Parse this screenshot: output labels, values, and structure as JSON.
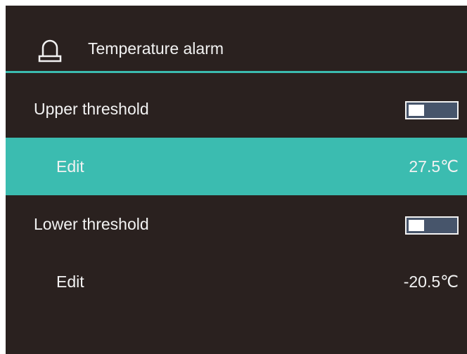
{
  "header": {
    "icon": "alarm-beacon-icon",
    "title": "Temperature alarm"
  },
  "rows": [
    {
      "label": "Upper threshold",
      "control": "toggle",
      "toggle_on": false
    },
    {
      "label": "Edit",
      "value": "27.5℃",
      "selected": true
    },
    {
      "label": "Lower threshold",
      "control": "toggle",
      "toggle_on": false
    },
    {
      "label": "Edit",
      "value": "-20.5℃",
      "selected": false
    }
  ],
  "colors": {
    "background": "#2a211f",
    "accent": "#3bbcb0",
    "toggle_track": "#47556b",
    "text": "#f2f2f2"
  }
}
